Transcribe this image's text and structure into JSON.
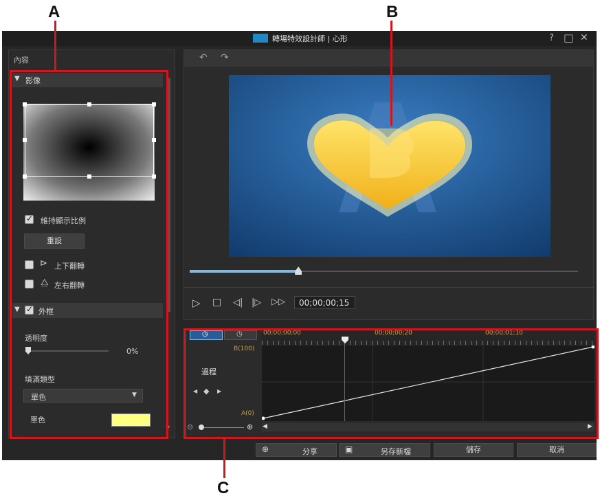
{
  "callouts": {
    "a": "A",
    "b": "B",
    "c": "C"
  },
  "window": {
    "title": "轉場特效設計師 | 心形",
    "help": "?",
    "restore": "□",
    "close": "✕"
  },
  "left_panel": {
    "header": "內容",
    "image_section": {
      "title": "影像",
      "keep_ratio_label": "維持顯示比例",
      "reset_label": "重設",
      "flip_vertical_label": "上下翻轉",
      "flip_horizontal_label": "左右翻轉",
      "keep_ratio_checked": true,
      "flip_vertical_checked": false,
      "flip_horizontal_checked": false
    },
    "border_section": {
      "title": "外框",
      "checked": true,
      "opacity_label": "透明度",
      "opacity_value": "0%",
      "fill_type_label": "填滿類型",
      "fill_type_value": "單色",
      "solid_color_label": "單色",
      "solid_color": "#ffff80"
    }
  },
  "preview": {
    "undo_icon": "undo-icon",
    "redo_icon": "redo-icon",
    "progress": 0.28,
    "timecode": "00;00;00;15",
    "background_color": "#1e5a9c",
    "heart_color": "#f4c12a"
  },
  "timeline": {
    "tab1_icon": "clock-icon",
    "tab2_icon": "clock-icon",
    "ruler_labels": [
      "00;00;00;00",
      "00;00;00;20",
      "00;00;01;10"
    ],
    "track_label": "過程",
    "y_top_label": "B(100)",
    "y_bottom_label": "A(0)"
  },
  "bottom_buttons": {
    "share": "分享",
    "save_as": "另存新檔",
    "save": "儲存",
    "cancel": "取消"
  },
  "colors": {
    "callout_red": "#d2161b",
    "window_bg": "#262626",
    "panel_bg": "#303030"
  }
}
